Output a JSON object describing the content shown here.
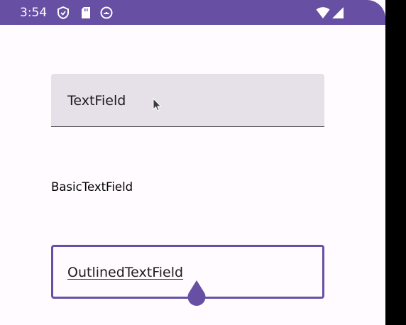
{
  "status_bar": {
    "time": "3:54",
    "left_icons": [
      "shield-icon",
      "sd-card-icon",
      "notification-icon"
    ],
    "right_icons": [
      "wifi-icon",
      "signal-icon"
    ]
  },
  "fields": {
    "textfield_value": "TextField",
    "basic_value": "BasicTextField",
    "outlined_value": "OutlinedTextField"
  },
  "colors": {
    "primary": "#6750a4",
    "filled_container": "#e6e0e9",
    "background": "#fffbfe",
    "on_surface": "#1d1b20"
  }
}
